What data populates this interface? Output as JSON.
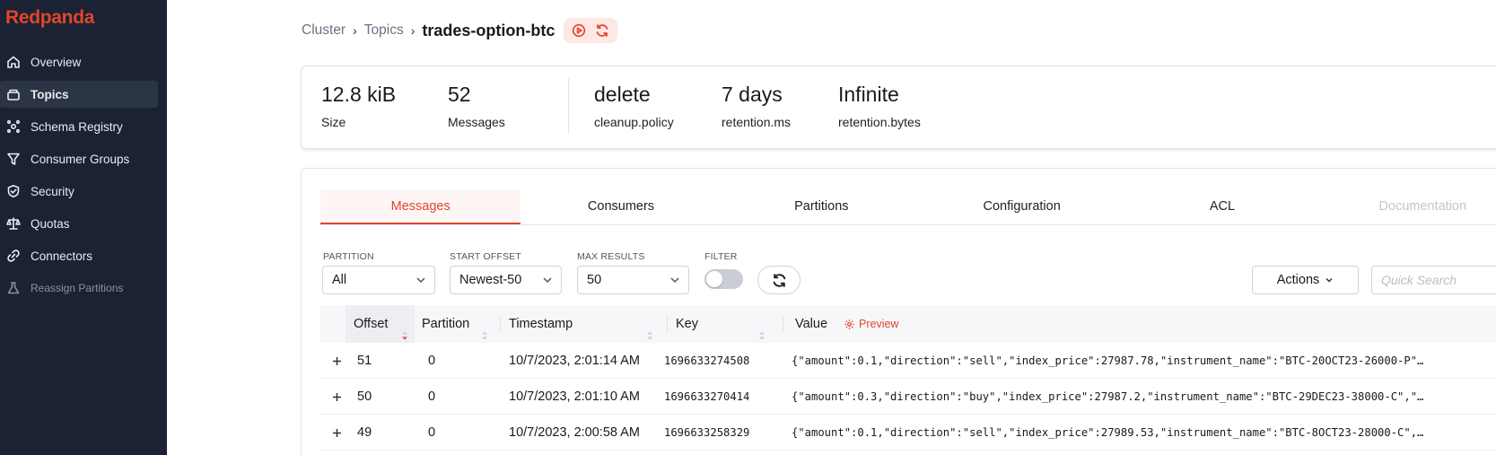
{
  "brand": "Redpanda",
  "sidebar": {
    "items": [
      {
        "label": "Overview",
        "icon": "home-icon"
      },
      {
        "label": "Topics",
        "icon": "layers-icon",
        "active": true
      },
      {
        "label": "Schema Registry",
        "icon": "schema-icon"
      },
      {
        "label": "Consumer Groups",
        "icon": "filter-icon"
      },
      {
        "label": "Security",
        "icon": "shield-icon"
      },
      {
        "label": "Quotas",
        "icon": "scale-icon"
      },
      {
        "label": "Connectors",
        "icon": "link-icon"
      },
      {
        "label": "Reassign Partitions",
        "icon": "flask-icon",
        "disabled": true
      }
    ]
  },
  "breadcrumb": {
    "cluster": "Cluster",
    "topics": "Topics",
    "current": "trades-option-btc"
  },
  "stats": {
    "size_value": "12.8 kiB",
    "size_label": "Size",
    "messages_value": "52",
    "messages_label": "Messages",
    "cleanup_value": "delete",
    "cleanup_label": "cleanup.policy",
    "retention_ms_value": "7 days",
    "retention_ms_label": "retention.ms",
    "retention_bytes_value": "Infinite",
    "retention_bytes_label": "retention.bytes"
  },
  "tabs": [
    "Messages",
    "Consumers",
    "Partitions",
    "Configuration",
    "ACL",
    "Documentation"
  ],
  "filters": {
    "partition_label": "PARTITION",
    "partition_value": "All",
    "start_offset_label": "START OFFSET",
    "start_offset_value": "Newest-50",
    "max_results_label": "MAX RESULTS",
    "max_results_value": "50",
    "filter_label": "FILTER",
    "actions_label": "Actions",
    "search_placeholder": "Quick Search"
  },
  "table": {
    "headers": {
      "offset": "Offset",
      "partition": "Partition",
      "timestamp": "Timestamp",
      "key": "Key",
      "value": "Value",
      "preview": "Preview"
    },
    "rows": [
      {
        "offset": "51",
        "partition": "0",
        "timestamp": "10/7/2023, 2:01:14 AM",
        "key": "1696633274508",
        "value": "{\"amount\":0.1,\"direction\":\"sell\",\"index_price\":27987.78,\"instrument_name\":\"BTC-20OCT23-26000-P\"…"
      },
      {
        "offset": "50",
        "partition": "0",
        "timestamp": "10/7/2023, 2:01:10 AM",
        "key": "1696633270414",
        "value": "{\"amount\":0.3,\"direction\":\"buy\",\"index_price\":27987.2,\"instrument_name\":\"BTC-29DEC23-38000-C\",\"…"
      },
      {
        "offset": "49",
        "partition": "0",
        "timestamp": "10/7/2023, 2:00:58 AM",
        "key": "1696633258329",
        "value": "{\"amount\":0.1,\"direction\":\"sell\",\"index_price\":27989.53,\"instrument_name\":\"BTC-8OCT23-28000-C\",…"
      }
    ]
  },
  "colors": {
    "accent": "#e0462a",
    "sidebar_bg": "#1a2233"
  }
}
